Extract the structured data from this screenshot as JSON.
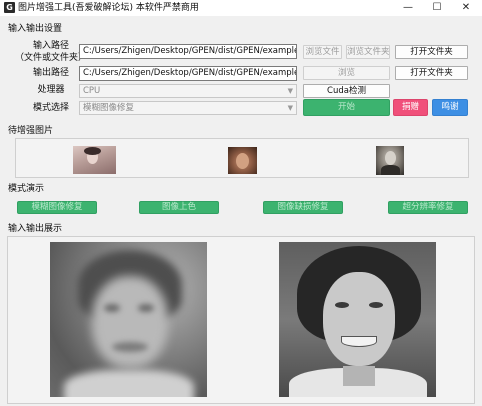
{
  "window": {
    "icon_letter": "G",
    "title": "图片增强工具(吾爱破解论坛) 本软件严禁商用",
    "minimize_glyph": "—",
    "maximize_glyph": "☐",
    "close_glyph": "✕"
  },
  "io_settings": {
    "section_title": "输入输出设置",
    "input_path_label_1": "输入路径",
    "input_path_label_2": "（文件或文件夹）",
    "input_path_value": "C:/Users/Zhigen/Desktop/GPEN/dist/GPEN/examples\\imgs",
    "browse_file_label": "浏览文件",
    "browse_folder_label": "浏览文件夹",
    "open_folder_in_label": "打开文件夹",
    "output_path_label": "输出路径",
    "output_path_value": "C:/Users/Zhigen/Desktop/GPEN/dist/GPEN/examples\\outs",
    "browse_output_label": "浏览",
    "open_folder_out_label": "打开文件夹",
    "processor_label": "处理器",
    "processor_value": "CPU",
    "cuda_check_label": "Cuda检测",
    "mode_label": "模式选择",
    "mode_value": "模糊图像修复",
    "start_label": "开始",
    "donate_label": "捐赠",
    "thanks_label": "鸣谢"
  },
  "pending_images": {
    "section_title": "待增强图片"
  },
  "mode_demo": {
    "section_title": "模式演示",
    "buttons": [
      "模糊图像修复",
      "图像上色",
      "图像缺损修复",
      "超分辨率修复"
    ]
  },
  "io_display": {
    "section_title": "输入输出展示"
  },
  "colors": {
    "accent_green": "#3cb36f",
    "donate_pink": "#f0507a",
    "thanks_blue": "#3d8fe4"
  }
}
